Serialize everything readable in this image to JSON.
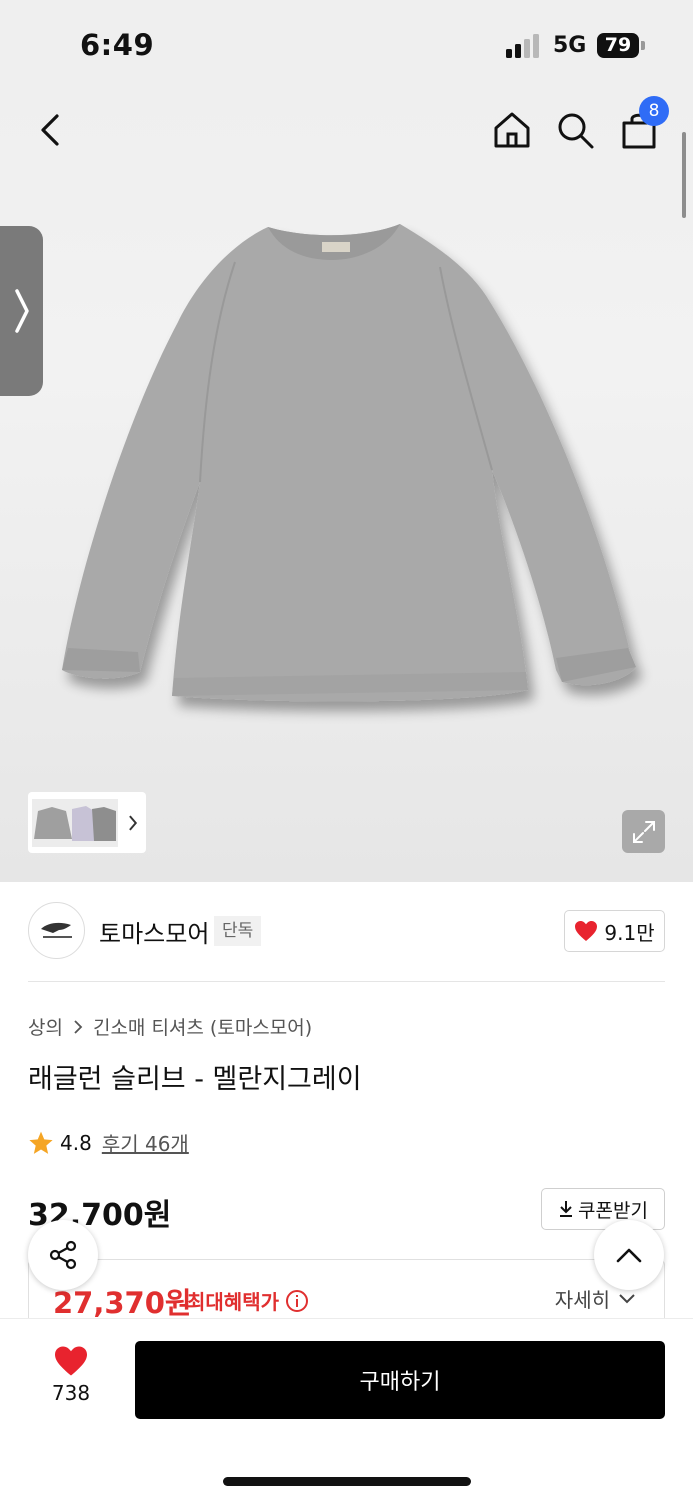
{
  "status_bar": {
    "time": "6:49",
    "network": "5G",
    "battery": "79"
  },
  "colors": {
    "accent_blue": "#2f6cf6",
    "sale_red": "#e02f2f",
    "heart_red": "#e8232e",
    "star_orange": "#f5a524"
  },
  "nav": {
    "back_icon": "chevron-left-icon",
    "home_icon": "home-icon",
    "search_icon": "search-icon",
    "cart_icon": "shopping-bag-icon",
    "cart_count": "8"
  },
  "gallery": {
    "thumb_more_icon": "chevron-right-icon",
    "expand_icon": "expand-icon"
  },
  "brand": {
    "name": "토마스모어",
    "tag": "단독",
    "likes": "9.1만"
  },
  "breadcrumb": {
    "category": "상의",
    "subcategory": "긴소매 티셔츠 (토마스모어)"
  },
  "product": {
    "title": "래글런 슬리브 - 멜란지그레이",
    "rating": "4.8",
    "review_label": "후기 46개",
    "price": "32,700원",
    "coupon_label": "쿠폰받기",
    "sale_price": "27,370원",
    "benefit_label": "최대혜택가",
    "detail_label": "자세히"
  },
  "bottom_bar": {
    "wish_count": "738",
    "buy_label": "구매하기"
  }
}
